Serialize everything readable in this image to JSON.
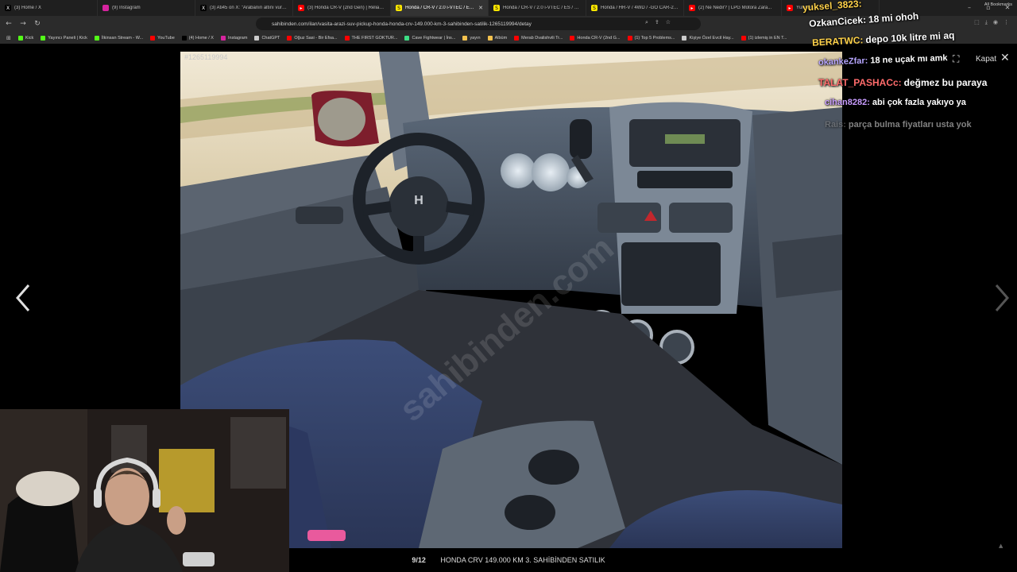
{
  "tabs": [
    {
      "title": "(3) Home / X",
      "favicon": "x-icon",
      "color": "#000000",
      "glyph": "X"
    },
    {
      "title": "(9) Instagram",
      "favicon": "instagram-icon",
      "color": "#d6249f",
      "glyph": ""
    },
    {
      "title": "(3) Ati45 on X: \"Arabanın altını vurdu...",
      "favicon": "x-icon",
      "color": "#000000",
      "glyph": "X"
    },
    {
      "title": "(3) Honda CR-V (2nd Gen) | Reliabili...",
      "favicon": "youtube-icon",
      "color": "#ff0000",
      "glyph": "▸"
    },
    {
      "title": "Honda / CR-V / 2.0 i-VTEC / ES /...",
      "favicon": "sahibinden-icon",
      "color": "#ffe800",
      "glyph": "S",
      "active": true
    },
    {
      "title": "Honda / CR-V / 2.0 i-VTEC / ES / MA...",
      "favicon": "sahibinden-icon",
      "color": "#ffe800",
      "glyph": "S"
    },
    {
      "title": "Honda / HR-V / 4WD / -GO CAR-20...",
      "favicon": "sahibinden-icon",
      "color": "#ffe800",
      "glyph": "S"
    },
    {
      "title": "(2) Ne Nedir? | LPG Motora Zara...",
      "favicon": "youtube-icon",
      "color": "#ff0000",
      "glyph": "▸"
    },
    {
      "title": "Yüksek...",
      "favicon": "youtube-icon",
      "color": "#ff0000",
      "glyph": "▸"
    }
  ],
  "address_bar": {
    "url": "sahibinden.com/ilan/vasita-arazi-suv-pickup-honda-honda-crv-149.000-km-3-sahibinden-satilik-1265119994/detay"
  },
  "bookmarks": [
    {
      "label": "Kick",
      "color": "#53fc18"
    },
    {
      "label": "Yayıncı Paneli | Kick",
      "color": "#53fc18"
    },
    {
      "label": "İlkinsan Stream - W...",
      "color": "#53fc18"
    },
    {
      "label": "YouTube",
      "color": "#ff0000"
    },
    {
      "label": "(4) Home / X",
      "color": "#000000"
    },
    {
      "label": "Instagram",
      "color": "#d6249f"
    },
    {
      "label": "ChatGPT",
      "color": "#cccccc"
    },
    {
      "label": "Oğuz Sasi - Bir Efsa...",
      "color": "#ff0000"
    },
    {
      "label": "THE FIRST GOKTUR...",
      "color": "#ff0000"
    },
    {
      "label": "Cave Fightwear | İns...",
      "color": "#3ddc84"
    },
    {
      "label": "yayın",
      "color": "#f2c14e"
    },
    {
      "label": "Albüm",
      "color": "#f2c14e"
    },
    {
      "label": "Merab Dvalishvili Tr...",
      "color": "#ff0000"
    },
    {
      "label": "Honda CR-V (2nd G...",
      "color": "#ff0000"
    },
    {
      "label": "(1) Top 5 Problems...",
      "color": "#ff0000"
    },
    {
      "label": "Kişiye Özel Evcil Hay...",
      "color": "#cccccc"
    },
    {
      "label": "(1) izlemiş in EN T...",
      "color": "#ff0000"
    }
  ],
  "bookmarks_end": "All Bookmarks",
  "gallery": {
    "listing_id": "#1265119994",
    "counter": "9/12",
    "caption": "HONDA CRV 149.000 KM 3. SAHİBİNDEN SATILIK",
    "close_label": "Kapat",
    "watermark": "sahibinden.com"
  },
  "chat": [
    {
      "user": "yuksel_3823:",
      "text": "",
      "color": "#ffd24a"
    },
    {
      "user": "OzkanCicek:",
      "text": "18 mi ohoh",
      "color": "#ffffff"
    },
    {
      "user": "BERATWC:",
      "text": "depo 10k litre mi aq",
      "color": "#ffd24a"
    },
    {
      "user": "okankeZfar:",
      "text": "18 ne uçak mı amk",
      "color": "#b7a6ff"
    },
    {
      "user": "TALAT_PASHACc:",
      "text": "değmez bu paraya",
      "color": "#ff6b6b"
    },
    {
      "user": "cihan8282:",
      "text": "abi çok fazla yakıyo ya",
      "color": "#c89cff"
    },
    {
      "user": "Rais:",
      "text": "parça bulma fiyatları usta yok",
      "color": "#888888"
    }
  ],
  "colors": {
    "accent": "#ffe800",
    "background": "#000000"
  }
}
